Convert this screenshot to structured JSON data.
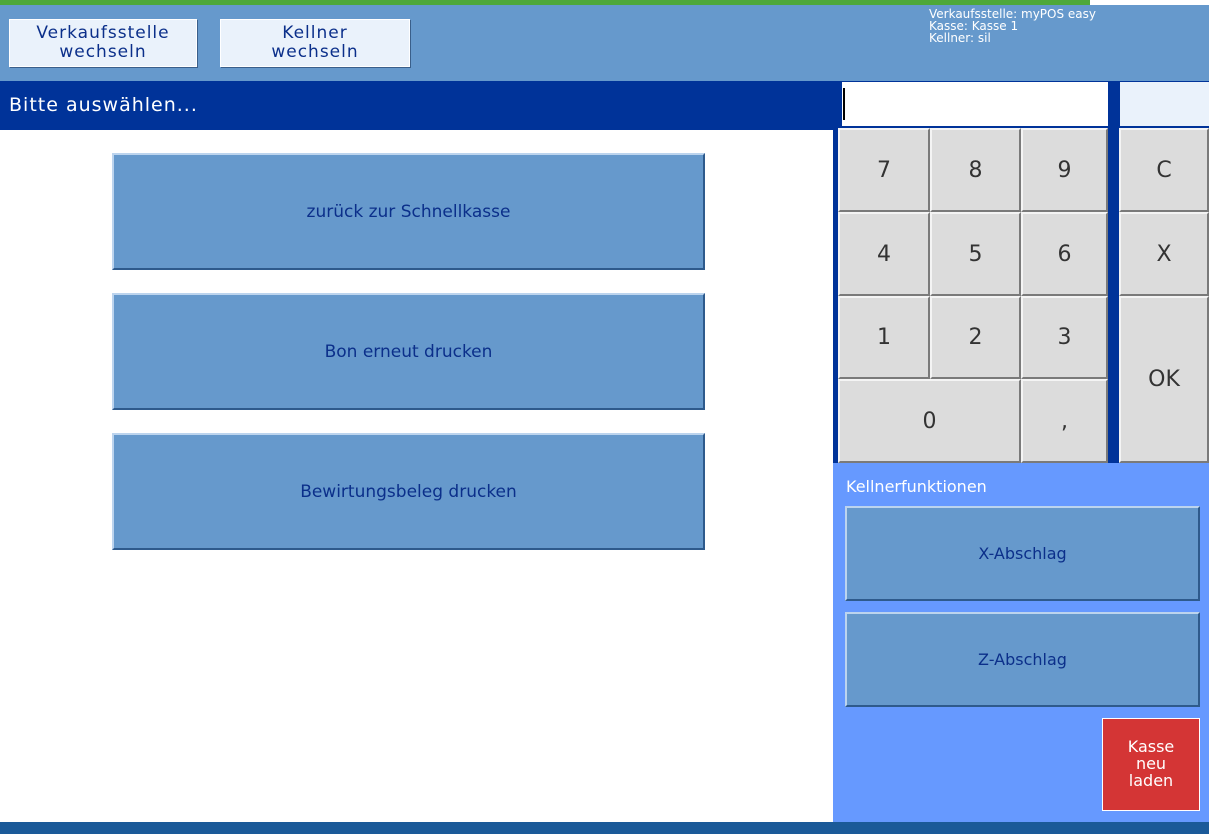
{
  "header": {
    "buttons": {
      "verkaufsstelle": [
        "Verkaufsstelle",
        "wechseln"
      ],
      "kellner": [
        "Kellner",
        "wechseln"
      ]
    },
    "info": [
      "Verkaufsstelle: myPOS easy",
      "Kasse: Kasse 1",
      "Kellner: sil"
    ]
  },
  "main": {
    "title": "Bitte auswählen...",
    "buttons": [
      "zurück zur Schnellkasse",
      "Bon erneut drucken",
      "Bewirtungsbeleg drucken"
    ]
  },
  "keypad": {
    "display_value": "",
    "keys": [
      "7",
      "8",
      "9",
      "C",
      "4",
      "5",
      "6",
      "X",
      "1",
      "2",
      "3",
      "OK",
      "0",
      ","
    ]
  },
  "kellnerfunktionen": {
    "title": "Kellnerfunktionen",
    "buttons": [
      "X-Abschlag",
      "Z-Abschlag"
    ],
    "reload": [
      "Kasse",
      "neu",
      "laden"
    ]
  },
  "colors": {
    "header_bg": "#6699cc",
    "title_bar": "#003399",
    "panel_bg": "#6699ff",
    "reload_button": "#d43535",
    "top_stripe": "#4ea83a"
  }
}
